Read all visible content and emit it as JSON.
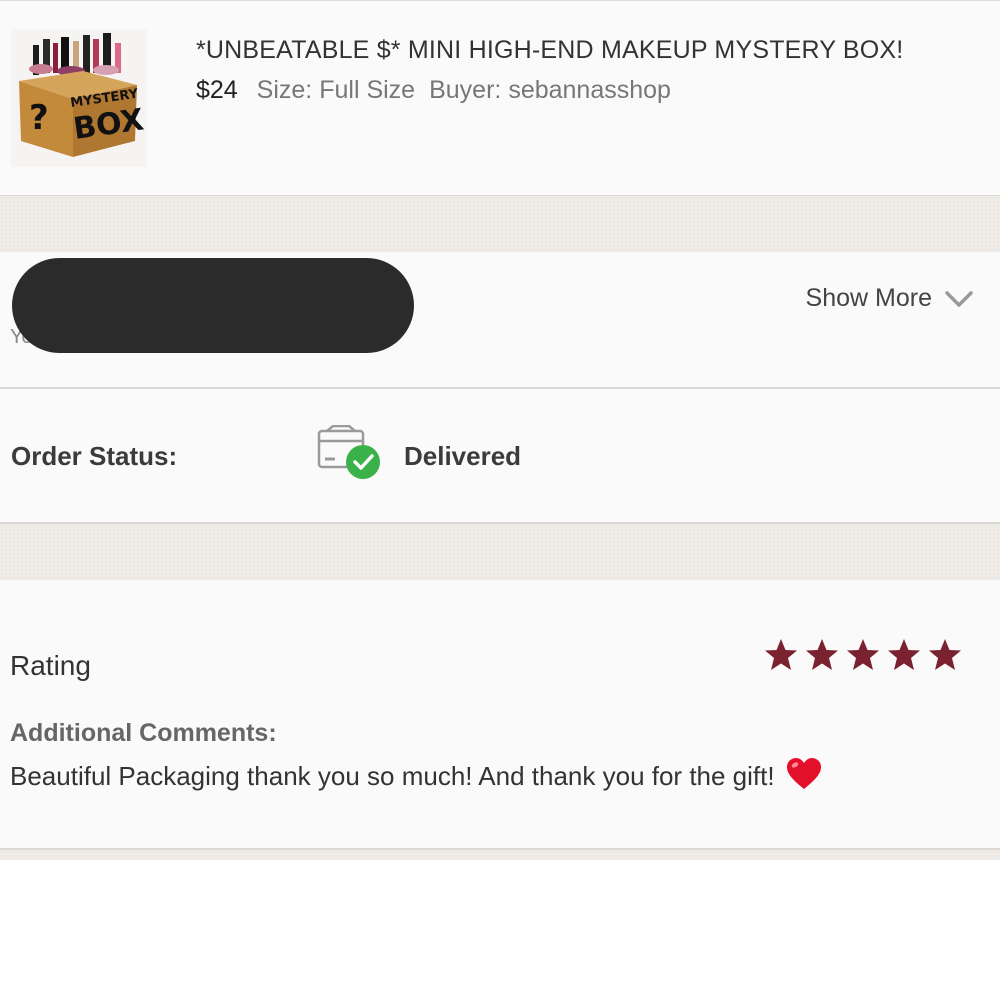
{
  "product": {
    "image_alt": "? MYSTERY BOX",
    "title": "*UNBEATABLE $* MINI HIGH-END MAKEUP MYSTERY BOX!",
    "price": "$24",
    "size_label": "Size:",
    "size_value": "Full Size",
    "buyer_label": "Buyer:",
    "buyer_value": "sebannasshop"
  },
  "user_section": {
    "partial_text": "Yo",
    "show_more_label": "Show More",
    "icon": "chevron-down-icon"
  },
  "order": {
    "status_label": "Order Status:",
    "status_value": "Delivered",
    "status_icon": "package-delivered-icon",
    "status_color": "#3bb14a"
  },
  "rating": {
    "label": "Rating",
    "stars": 5,
    "max_stars": 5,
    "star_color": "#7b2230",
    "comments_label": "Additional Comments:",
    "comments_text": "Beautiful Packaging thank you so much! And thank you for the gift!",
    "comment_emoji": "heart-icon"
  }
}
